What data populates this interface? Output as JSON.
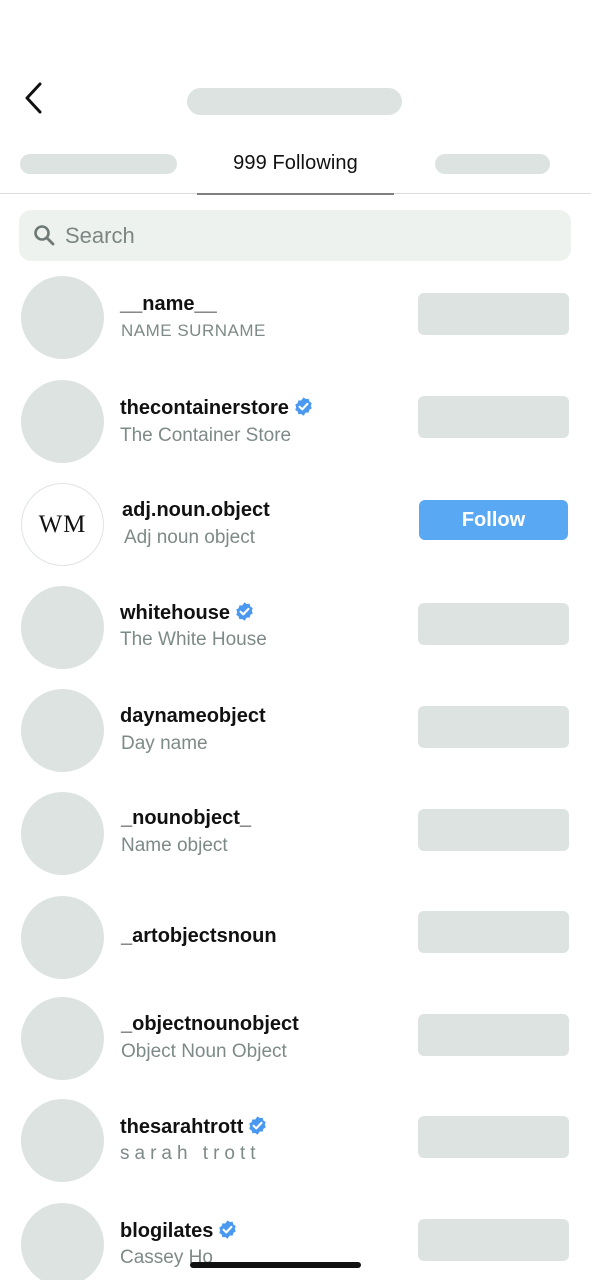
{
  "header": {
    "active_tab_label": "999 Following"
  },
  "search": {
    "placeholder": "Search"
  },
  "colors": {
    "placeholder_gray": "#dde3e0",
    "follow_blue": "#58a8f3",
    "verified_blue": "#4a98f0"
  },
  "icons": {
    "back": "chevron-left-icon",
    "search": "search-icon",
    "verified": "verified-badge-icon"
  },
  "accounts": [
    {
      "username": "__name__",
      "full_name": "NAME SURNAME",
      "verified": false
    },
    {
      "username": "thecontainerstore",
      "full_name": "The Container Store",
      "verified": true
    },
    {
      "username": "adj.noun.object",
      "full_name": "Adj noun object",
      "verified": false,
      "avatar_text": "WM",
      "button_label": "Follow"
    },
    {
      "username": "whitehouse",
      "full_name": "The White House",
      "verified": true
    },
    {
      "username": "daynameobject",
      "full_name": "Day name",
      "verified": false
    },
    {
      "username": "_nounobject_",
      "full_name": "Name object",
      "verified": false
    },
    {
      "username": "_artobjectsnoun",
      "full_name": "",
      "verified": false
    },
    {
      "username": "_objectnounobject",
      "full_name": "Object Noun Object",
      "verified": false
    },
    {
      "username": "thesarahtrott",
      "full_name": "sarah trott",
      "verified": true
    },
    {
      "username": "blogilates",
      "full_name": "Cassey Ho",
      "verified": true
    }
  ]
}
